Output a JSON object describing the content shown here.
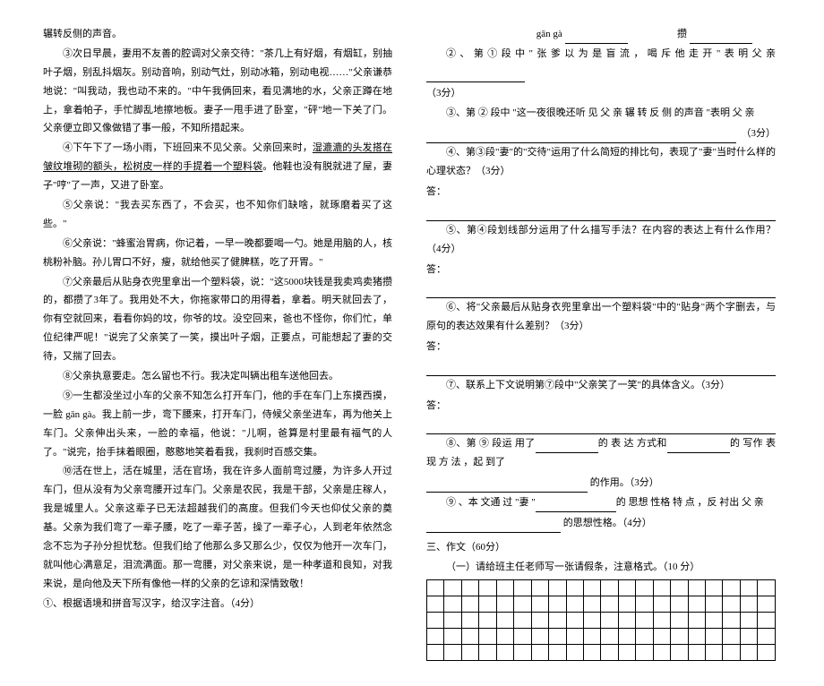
{
  "left": {
    "p_cont": "辗转反侧的声音。",
    "p3": "③次日早晨，妻用不友善的腔调对父亲交待：\"茶几上有好烟，有烟缸，别抽叶子烟，别乱抖烟灰。别动音响，别动气灶，别动冰箱，别动电视……\"父亲谦恭地说：\"叫我动，我也动不来的。\"中午我俩回来，看见满地的水，父亲正蹲在地上，拿着帕子，手忙脚乱地擦地板。妻子一甩手进了卧室，\"砰\"地一下关了门。父亲便立即又像做错了事一般，不知所措起来。",
    "p4a": "④下午下了一场小雨，下班回来不见父亲。父亲回来时，",
    "p4b": "湿漉漉的头发搭在皱纹堆砌的额头，松树皮一样的手提着一个塑料袋",
    "p4c": "。他鞋也没有脱就进了屋，妻子\"哼\"了一声，又进了卧室。",
    "p5": "⑤父亲说：\"我去买东西了，不会买，也不知你们缺啥，就琢磨着买了这些。\"",
    "p6": "⑥父亲说：\"蜂蜜治胃病，你记着，一早一晚都要喝一勺。她是用脑的人，核桃粉补脑。孙儿胃口不好，瘦，就给他买了健脾糕，吃了开胃。\"",
    "p7": "⑦父亲最后从贴身衣兜里拿出一个塑料袋，说：\"这5000块钱是我卖鸡卖猪攒的，都攒了3年了。我用处不大，你拖家带口的用得着，拿着。明天就回去了，你有空就回来，看看你妈的坟，你爷的坟。没空回来，爸也不怪你，你们忙，单位纪律严呢！\"说完了父亲笑了一笑，摸出叶子烟，正要点，可能想起了妻的交待，又揣了回去。",
    "p8": "⑧父亲执意要走。怎么留也不行。我决定叫辆出租车送他回去。",
    "p9": "⑨一生都没坐过小车的父亲不知怎么打开车门，他的手在车门上东摸西摸，一脸 gān gà。我上前一步，弯下腰来，打开车门，侍候父亲坐进车，再为他关上车门。父亲伸出头来，一脸的幸福，他说：\"儿啊，爸算是村里最有福气的人了。\"说完，抬手抹着眼圈，憨憨地笑着看我，我刹时百感交集。",
    "p10": "⑩活在世上，活在城里，活在官场，我在许多人面前弯过腰，为许多人开过车门，但从没有为父亲弯腰开过车门。父亲是农民，我是干部，父亲是庄稼人，我是城里人。父亲这辈子已无法超越我们的高度。但我们今天也仰仗父亲的奠基。父亲为我们弯了一辈子腰，吃了一辈子苦，操了一辈子心，人到老年依然念念不忘为子孙分担忧愁。但我们给了他那么多又那么少，仅仅为他开一次车门，就叫他心满意足，泪流满面。那一弯腰，对父亲来说，是一种孝道和良知，对我来说，是向他及天下所有像他一样的父亲的乞谅和深情致敬！",
    "q1": "①、根据语境和拼音写汉字，给汉字注音。（4分）"
  },
  "right": {
    "q1_line": "gān  gà",
    "q1_b": "攒",
    "q2": "②、第①段中\"张爹以为是盲流，喝斥他走开\"表明父亲",
    "q2_score": "（3分）",
    "q3a": "③、第 ② 段中 \"这一夜很晚还听 见 父 亲 辗 转 反 侧 的声音 \"表明 父 亲",
    "q3b": "（3分）",
    "q4": "④、第③段\"妻\"的\"交待\"运用了什么简短的排比句，表现了\"妻\"当时什么样的心理状态？（3分）",
    "ans_label": "答：",
    "q5": "⑤、第④段划线部分运用了什么描写手法？在内容的表达上有什么作用？（4分）",
    "q6": "⑥、将\"父亲最后从贴身衣兜里拿出一个塑料袋\"中的\"贴身\"两个字删去，与原句的表达效果有什么差别？（3分）",
    "q7": "⑦、联系上下文说明第⑦段中\"父亲笑了一笑\"的具体含义。（3分）",
    "q8a": "⑧、第 ⑨ 段运 用了",
    "q8b": "的 表 达 方式和",
    "q8c": "的 写作 表现 方 法 ，起 到了",
    "q8d": "的作用。（3分）",
    "q9a": "⑨ 、本 文通 过 \"妻 \"",
    "q9b": "的 思想 性格 特 点 ，反 衬出 父 亲",
    "q9c": "的思想性格。（4分）",
    "section3": "三、作文（60分）",
    "sub1": "（一）请给班主任老师写一张请假条，注意格式。（10 分）"
  }
}
